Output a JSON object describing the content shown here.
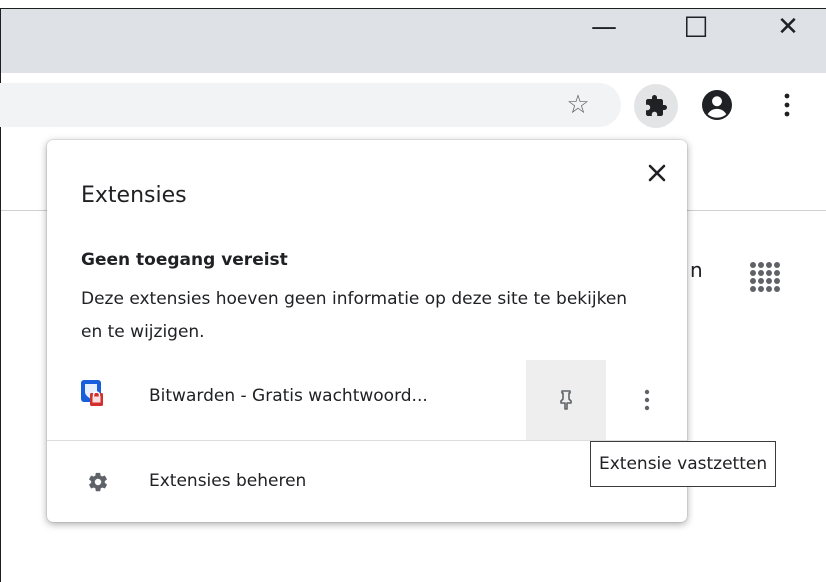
{
  "window": {
    "minimize_glyph": "—",
    "maximize_glyph": "☐",
    "close_glyph": "✕"
  },
  "toolbar": {
    "icons": [
      "star-icon",
      "puzzle-icon",
      "account-icon",
      "menu-icon"
    ],
    "star_glyph": "☆"
  },
  "page_background": {
    "partial_text": "n",
    "icons": [
      "apps-grid-icon"
    ]
  },
  "extensions_popup": {
    "title": "Extensies",
    "close_glyph": "✕",
    "section_heading": "Geen toegang vereist",
    "section_description": "Deze extensies hoeven geen informatie op deze site te bekijken en te wijzigen.",
    "extensions": [
      {
        "name": "Bitwarden - Gratis wachtwoord...",
        "icon": "bitwarden-icon"
      }
    ],
    "manage_label": "Extensies beheren"
  },
  "tooltip": {
    "text": "Extensie vastzetten"
  },
  "colors": {
    "titlebar": "#dee1e6",
    "omnibox": "#f1f3f4",
    "bitwarden_blue": "#175ddc",
    "bitwarden_red": "#d32f2f",
    "icon_gray": "#5f6368",
    "pin_hover": "#eeeeee"
  }
}
